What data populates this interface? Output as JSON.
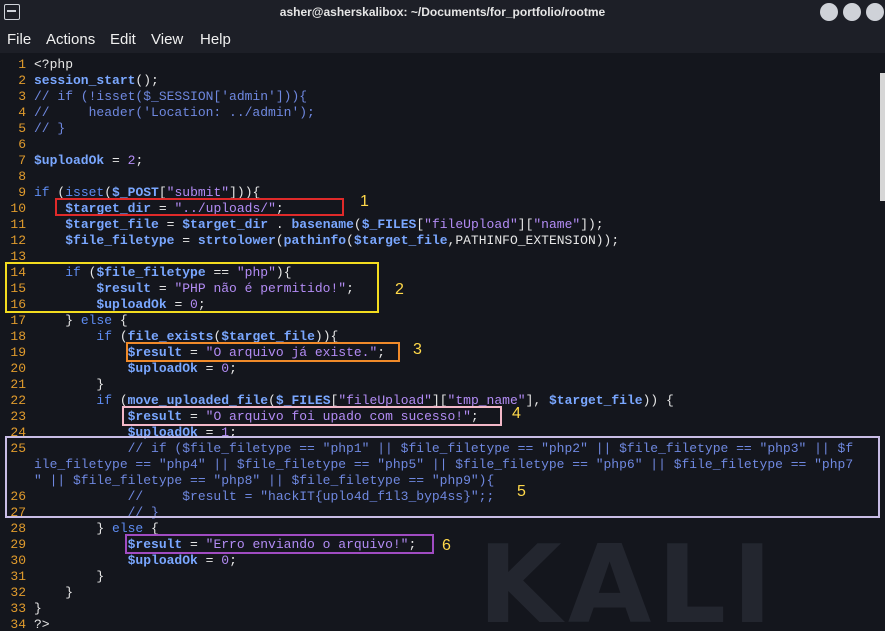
{
  "window": {
    "title": "asher@asherskalibox: ~/Documents/for_portfolio/rootme"
  },
  "menu": [
    "File",
    "Actions",
    "Edit",
    "View",
    "Help"
  ],
  "watermark": "KALI",
  "annotations": [
    "1",
    "2",
    "3",
    "4",
    "5",
    "6"
  ],
  "colors": {
    "highlight_1": "#e02a2a",
    "highlight_2": "#f3dc1f",
    "highlight_3": "#f08a2a",
    "highlight_4": "#f3b8c8",
    "highlight_5": "#c9bde6",
    "highlight_6": "#a04cc2"
  },
  "code_lines": [
    {
      "n": "1",
      "t": [
        [
          "p",
          "<?php"
        ]
      ]
    },
    {
      "n": "2",
      "t": [
        [
          "f",
          "session_start"
        ],
        [
          "p",
          "();"
        ]
      ]
    },
    {
      "n": "3",
      "t": [
        [
          "c",
          "// if (!isset($_SESSION['admin'])){"
        ]
      ]
    },
    {
      "n": "4",
      "t": [
        [
          "c",
          "//     header('Location: ../admin');"
        ]
      ]
    },
    {
      "n": "5",
      "t": [
        [
          "c",
          "// }"
        ]
      ]
    },
    {
      "n": "6",
      "t": []
    },
    {
      "n": "7",
      "t": [
        [
          "v",
          "$uploadOk"
        ],
        [
          "p",
          " = "
        ],
        [
          "n",
          "2"
        ],
        [
          "p",
          ";"
        ]
      ]
    },
    {
      "n": "8",
      "t": []
    },
    {
      "n": "9",
      "t": [
        [
          "k",
          "if"
        ],
        [
          "p",
          " ("
        ],
        [
          "k",
          "isset"
        ],
        [
          "p",
          "("
        ],
        [
          "v",
          "$_POST"
        ],
        [
          "p",
          "["
        ],
        [
          "s",
          "\"submit\""
        ],
        [
          "p",
          "])){"
        ]
      ]
    },
    {
      "n": "10",
      "t": [
        [
          "p",
          "    "
        ],
        [
          "v",
          "$target_dir"
        ],
        [
          "p",
          " = "
        ],
        [
          "s",
          "\"../uploads/\""
        ],
        [
          "p",
          ";"
        ]
      ]
    },
    {
      "n": "11",
      "t": [
        [
          "p",
          "    "
        ],
        [
          "v",
          "$target_file"
        ],
        [
          "p",
          " = "
        ],
        [
          "v",
          "$target_dir"
        ],
        [
          "p",
          " . "
        ],
        [
          "f",
          "basename"
        ],
        [
          "p",
          "("
        ],
        [
          "v",
          "$_FILES"
        ],
        [
          "p",
          "["
        ],
        [
          "s",
          "\"fileUpload\""
        ],
        [
          "p",
          "]["
        ],
        [
          "s",
          "\"name\""
        ],
        [
          "p",
          "]);"
        ]
      ]
    },
    {
      "n": "12",
      "t": [
        [
          "p",
          "    "
        ],
        [
          "v",
          "$file_filetype"
        ],
        [
          "p",
          " = "
        ],
        [
          "f",
          "strtolower"
        ],
        [
          "p",
          "("
        ],
        [
          "f",
          "pathinfo"
        ],
        [
          "p",
          "("
        ],
        [
          "v",
          "$target_file"
        ],
        [
          "p",
          ",PATHINFO_EXTENSION));"
        ]
      ]
    },
    {
      "n": "13",
      "t": []
    },
    {
      "n": "14",
      "t": [
        [
          "p",
          "    "
        ],
        [
          "k",
          "if"
        ],
        [
          "p",
          " ("
        ],
        [
          "v",
          "$file_filetype"
        ],
        [
          "p",
          " == "
        ],
        [
          "s",
          "\"php\""
        ],
        [
          "p",
          "){"
        ]
      ]
    },
    {
      "n": "15",
      "t": [
        [
          "p",
          "        "
        ],
        [
          "v",
          "$result"
        ],
        [
          "p",
          " = "
        ],
        [
          "s",
          "\"PHP não é permitido!\""
        ],
        [
          "p",
          ";"
        ]
      ]
    },
    {
      "n": "16",
      "t": [
        [
          "p",
          "        "
        ],
        [
          "v",
          "$uploadOk"
        ],
        [
          "p",
          " = "
        ],
        [
          "n",
          "0"
        ],
        [
          "p",
          ";"
        ]
      ]
    },
    {
      "n": "17",
      "t": [
        [
          "p",
          "    } "
        ],
        [
          "k",
          "else"
        ],
        [
          "p",
          " {"
        ]
      ]
    },
    {
      "n": "18",
      "t": [
        [
          "p",
          "        "
        ],
        [
          "k",
          "if"
        ],
        [
          "p",
          " ("
        ],
        [
          "f",
          "file_exists"
        ],
        [
          "p",
          "("
        ],
        [
          "v",
          "$target_file"
        ],
        [
          "p",
          ")){"
        ]
      ]
    },
    {
      "n": "19",
      "t": [
        [
          "p",
          "            "
        ],
        [
          "v",
          "$result"
        ],
        [
          "p",
          " = "
        ],
        [
          "s",
          "\"O arquivo já existe.\""
        ],
        [
          "p",
          ";"
        ]
      ]
    },
    {
      "n": "20",
      "t": [
        [
          "p",
          "            "
        ],
        [
          "v",
          "$uploadOk"
        ],
        [
          "p",
          " = "
        ],
        [
          "n",
          "0"
        ],
        [
          "p",
          ";"
        ]
      ]
    },
    {
      "n": "21",
      "t": [
        [
          "p",
          "        }"
        ]
      ]
    },
    {
      "n": "22",
      "t": [
        [
          "p",
          "        "
        ],
        [
          "k",
          "if"
        ],
        [
          "p",
          " ("
        ],
        [
          "f",
          "move_uploaded_file"
        ],
        [
          "p",
          "("
        ],
        [
          "v",
          "$_FILES"
        ],
        [
          "p",
          "["
        ],
        [
          "s",
          "\"fileUpload\""
        ],
        [
          "p",
          "]["
        ],
        [
          "s",
          "\"tmp_name\""
        ],
        [
          "p",
          "], "
        ],
        [
          "v",
          "$target_file"
        ],
        [
          "p",
          ")) {"
        ]
      ]
    },
    {
      "n": "23",
      "t": [
        [
          "p",
          "            "
        ],
        [
          "v",
          "$result"
        ],
        [
          "p",
          " = "
        ],
        [
          "s",
          "\"O arquivo foi upado com sucesso!\""
        ],
        [
          "p",
          ";"
        ]
      ]
    },
    {
      "n": "24",
      "t": [
        [
          "p",
          "            "
        ],
        [
          "v",
          "$uploadOk"
        ],
        [
          "p",
          " = "
        ],
        [
          "n",
          "1"
        ],
        [
          "p",
          ";"
        ]
      ]
    },
    {
      "n": "25",
      "t": [
        [
          "c",
          "            // if ($file_filetype == \"php1\" || $file_filetype == \"php2\" || $file_filetype == \"php3\" || $f"
        ]
      ]
    },
    {
      "n": "",
      "t": [
        [
          "c",
          "ile_filetype == \"php4\" || $file_filetype == \"php5\" || $file_filetype == \"php6\" || $file_filetype == \"php7"
        ]
      ]
    },
    {
      "n": "",
      "t": [
        [
          "c",
          "\" || $file_filetype == \"php8\" || $file_filetype == \"php9\"){"
        ]
      ]
    },
    {
      "n": "26",
      "t": [
        [
          "c",
          "            //     $result = \"hackIT{uplo4d_f1l3_byp4ss}\";;"
        ]
      ]
    },
    {
      "n": "27",
      "t": [
        [
          "c",
          "            // }"
        ]
      ]
    },
    {
      "n": "28",
      "t": [
        [
          "p",
          "        } "
        ],
        [
          "k",
          "else"
        ],
        [
          "p",
          " {"
        ]
      ]
    },
    {
      "n": "29",
      "t": [
        [
          "p",
          "            "
        ],
        [
          "v",
          "$result"
        ],
        [
          "p",
          " = "
        ],
        [
          "s",
          "\"Erro enviando o arquivo!\""
        ],
        [
          "p",
          ";"
        ]
      ]
    },
    {
      "n": "30",
      "t": [
        [
          "p",
          "            "
        ],
        [
          "v",
          "$uploadOk"
        ],
        [
          "p",
          " = "
        ],
        [
          "n",
          "0"
        ],
        [
          "p",
          ";"
        ]
      ]
    },
    {
      "n": "31",
      "t": [
        [
          "p",
          "        }"
        ]
      ]
    },
    {
      "n": "32",
      "t": [
        [
          "p",
          "    }"
        ]
      ]
    },
    {
      "n": "33",
      "t": [
        [
          "p",
          "}"
        ]
      ]
    },
    {
      "n": "34",
      "t": [
        [
          "p",
          "?>"
        ]
      ]
    }
  ]
}
